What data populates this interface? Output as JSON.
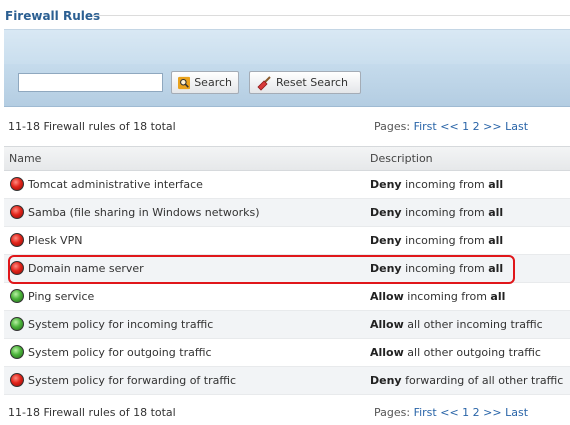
{
  "section_title": "Firewall Rules",
  "search": {
    "placeholder": "",
    "value": "",
    "search_label": "Search",
    "reset_label": "Reset Search"
  },
  "summary": {
    "count_text": "11-18 Firewall rules of 18 total",
    "pages_label": "Pages:",
    "first": "First",
    "prev": "<<",
    "page1": "1",
    "page2": "2",
    "next": ">>",
    "last": "Last"
  },
  "columns": {
    "name": "Name",
    "description": "Description"
  },
  "rows": [
    {
      "name": "Tomcat administrative interface",
      "status": "deny",
      "action": "Deny",
      "mid": "incoming from",
      "target": "all"
    },
    {
      "name": "Samba (file sharing in Windows networks)",
      "status": "deny",
      "action": "Deny",
      "mid": "incoming from",
      "target": "all"
    },
    {
      "name": "Plesk VPN",
      "status": "deny",
      "action": "Deny",
      "mid": "incoming from",
      "target": "all"
    },
    {
      "name": "Domain name server",
      "status": "deny",
      "action": "Deny",
      "mid": "incoming from",
      "target": "all"
    },
    {
      "name": "Ping service",
      "status": "allow",
      "action": "Allow",
      "mid": "incoming from",
      "target": "all"
    },
    {
      "name": "System policy for incoming traffic",
      "status": "allow",
      "action": "Allow",
      "mid": "all other incoming traffic",
      "target": ""
    },
    {
      "name": "System policy for outgoing traffic",
      "status": "allow",
      "action": "Allow",
      "mid": "all other outgoing traffic",
      "target": ""
    },
    {
      "name": "System policy for forwarding of traffic",
      "status": "deny",
      "action": "Deny",
      "mid": "forwarding of all other traffic",
      "target": ""
    }
  ],
  "colors": {
    "deny": "#e2241a",
    "allow": "#4bb33a",
    "link": "#2a65a8",
    "highlight": "#e0161a"
  }
}
